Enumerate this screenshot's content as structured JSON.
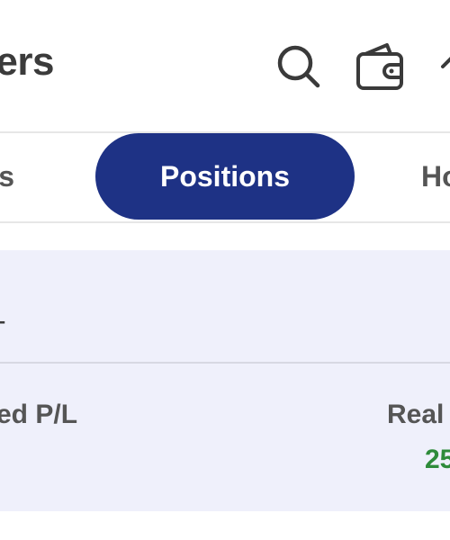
{
  "header": {
    "title": "ers",
    "icons": {
      "search": "search-icon",
      "wallet": "wallet-icon",
      "more": "chevron-up-icon"
    }
  },
  "tabs": [
    {
      "label": "s",
      "active": false
    },
    {
      "label": "Positions",
      "active": true
    },
    {
      "label": "Ho",
      "active": false
    }
  ],
  "summary": {
    "value": "-",
    "unrealized_label": "ed P/L",
    "realized_label": "Real",
    "realized_value": "25"
  },
  "colors": {
    "accent": "#1e3285",
    "summary_bg": "#eff0fb",
    "profit": "#2e8b3a"
  }
}
